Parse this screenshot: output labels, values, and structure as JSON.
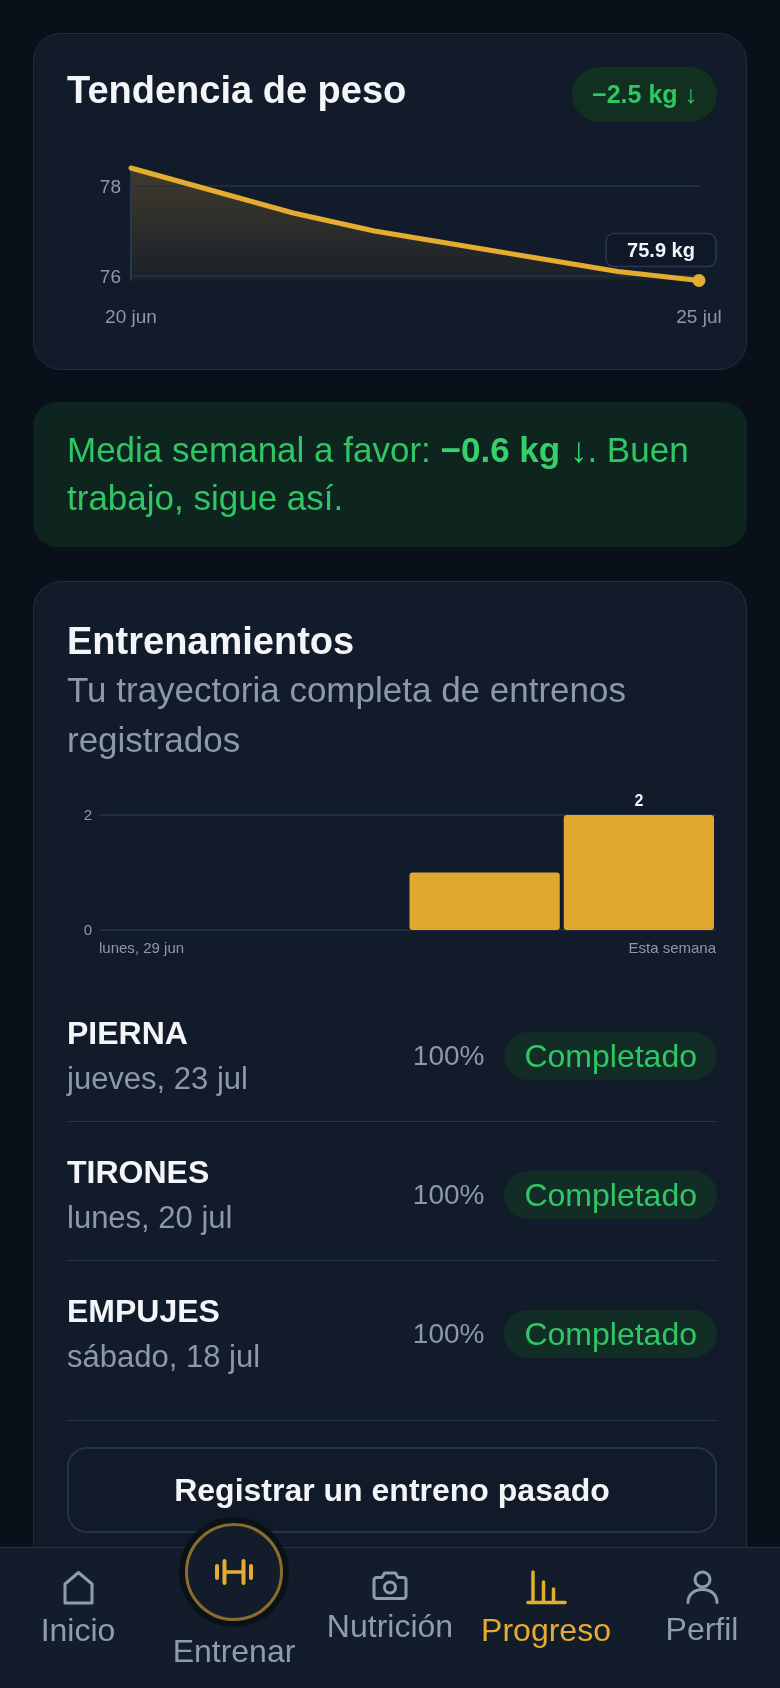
{
  "weight_card": {
    "title": "Tendencia de peso",
    "change_badge": "−2.5 kg ↓",
    "chart_data": {
      "type": "area",
      "categories": [
        "20 jun",
        null,
        null,
        null,
        null,
        null,
        null,
        "25 jul"
      ],
      "values": [
        78.4,
        77.9,
        77.4,
        77.0,
        76.7,
        76.4,
        76.1,
        75.9
      ],
      "ylim": [
        75.9,
        78.4
      ],
      "yticks": [
        76,
        78
      ],
      "annotations": [
        {
          "y": 75.9,
          "text": "75.9 kg"
        }
      ]
    }
  },
  "summary_banner": {
    "text": "Media semanal a favor: **−0.6 kg ↓**. Buen trabajo, sigue así."
  },
  "workouts_card": {
    "title": "Entrenamientos",
    "subtitle": "Tu trayectoria completa de entrenos registrados",
    "chart_data": {
      "type": "bar",
      "categories": [
        "lunes, 29 jun",
        null,
        null,
        "Esta semana"
      ],
      "values": [
        0,
        0,
        1,
        2
      ],
      "ylim": [
        0,
        2
      ],
      "yticks": [
        0,
        2
      ],
      "value_labels": [
        null,
        null,
        null,
        "2"
      ]
    },
    "sessions": [
      {
        "name": "PIERNA",
        "date": "jueves, 23 jul",
        "percent": "100%",
        "status": "Completado"
      },
      {
        "name": "TIRONES",
        "date": "lunes, 20 jul",
        "percent": "100%",
        "status": "Completado"
      },
      {
        "name": "EMPUJES",
        "date": "sábado, 18 jul",
        "percent": "100%",
        "status": "Completado"
      }
    ],
    "log_button": "Registrar un entreno pasado"
  },
  "bottom_nav": [
    {
      "label": "Inicio",
      "kind": "tab",
      "selected": false
    },
    {
      "label": "Entrenar",
      "kind": "action",
      "selected": false
    },
    {
      "label": "Nutrición",
      "kind": "tab",
      "selected": false
    },
    {
      "label": "Progreso",
      "kind": "tab",
      "selected": true
    },
    {
      "label": "Perfil",
      "kind": "tab",
      "selected": false
    }
  ]
}
